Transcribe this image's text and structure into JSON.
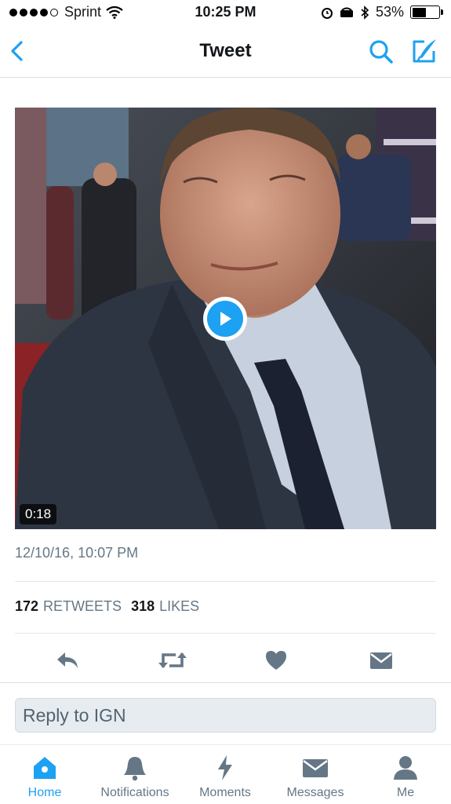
{
  "status_bar": {
    "carrier": "Sprint",
    "time": "10:25 PM",
    "battery_percent": "53%",
    "battery_level": 0.53
  },
  "nav": {
    "title": "Tweet",
    "icons": [
      "back-chevron-icon",
      "search-icon",
      "compose-icon"
    ]
  },
  "tweet": {
    "media": {
      "type": "video",
      "duration": "0:18"
    },
    "timestamp": "12/10/16, 10:07 PM",
    "retweets_count": "172",
    "retweets_label": "RETWEETS",
    "likes_count": "318",
    "likes_label": "LIKES",
    "actions": [
      "reply-icon",
      "retweet-icon",
      "like-icon",
      "direct-message-icon"
    ]
  },
  "reply": {
    "placeholder": "Reply to IGN"
  },
  "tabs": [
    {
      "label": "Home",
      "icon": "home-icon",
      "active": true
    },
    {
      "label": "Notifications",
      "icon": "bell-icon",
      "active": false
    },
    {
      "label": "Moments",
      "icon": "lightning-icon",
      "active": false
    },
    {
      "label": "Messages",
      "icon": "envelope-icon",
      "active": false
    },
    {
      "label": "Me",
      "icon": "person-icon",
      "active": false
    }
  ],
  "colors": {
    "accent": "#1da1f2",
    "icon_gray": "#657786",
    "text_dark": "#14171a"
  }
}
